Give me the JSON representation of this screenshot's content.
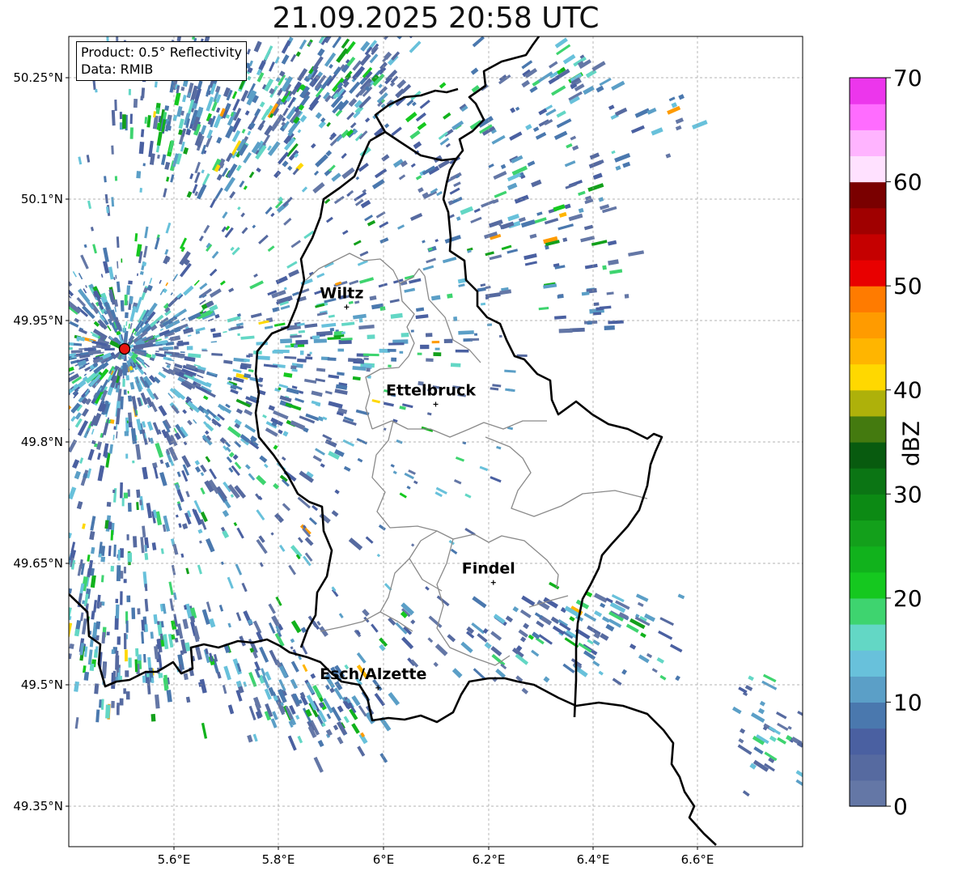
{
  "title": "21.09.2025 20:58 UTC",
  "info": {
    "product": "Product: 0.5° Reflectivity",
    "data": "Data: RMIB"
  },
  "map": {
    "lon_range": [
      5.4,
      6.8
    ],
    "lat_range": [
      49.3,
      50.3
    ],
    "lon_ticks": [
      "5.6°E",
      "5.8°E",
      "6°E",
      "6.2°E",
      "6.4°E",
      "6.6°E"
    ],
    "lat_ticks": [
      "50.25°N",
      "50.1°N",
      "49.95°N",
      "49.8°N",
      "49.65°N",
      "49.5°N",
      "49.35°N"
    ],
    "radar_site_color": "#e8150e",
    "cities": [
      {
        "name": "Wiltz",
        "lon": 5.93,
        "lat": 49.966
      },
      {
        "name": "Ettelbruck",
        "lon": 6.1,
        "lat": 49.846
      },
      {
        "name": "Findel",
        "lon": 6.21,
        "lat": 49.626
      },
      {
        "name": "Esch/Alzette",
        "lon": 5.99,
        "lat": 49.496
      }
    ]
  },
  "colorbar": {
    "label": "dBZ",
    "ticks": [
      "0",
      "10",
      "20",
      "30",
      "40",
      "50",
      "60",
      "70"
    ],
    "colors": [
      "#6477a6",
      "#566aa0",
      "#4a60a1",
      "#4a78ae",
      "#5b9fc7",
      "#68c1db",
      "#63d7c5",
      "#3ed46f",
      "#15c81f",
      "#11b21c",
      "#13a01b",
      "#0c8a14",
      "#0b7514",
      "#085b0f",
      "#447a0f",
      "#aeb10a",
      "#ffd800",
      "#ffb500",
      "#ff9b00",
      "#ff7b00",
      "#e80000",
      "#c50000",
      "#a00000",
      "#7a0000",
      "#ffe1ff",
      "#ffb4ff",
      "#ff6cff",
      "#ec36ec"
    ]
  }
}
